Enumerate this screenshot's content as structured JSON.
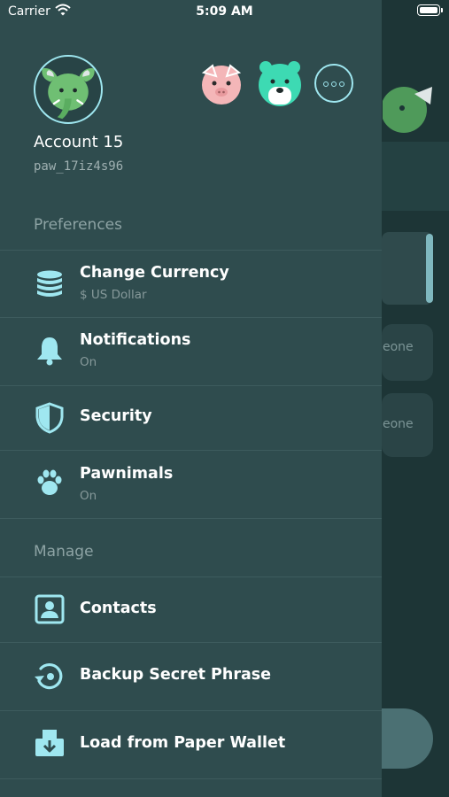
{
  "status_bar": {
    "carrier": "Carrier",
    "time": "5:09 AM"
  },
  "background": {
    "peek_text_1": "eone",
    "peek_text_2": "eone"
  },
  "account": {
    "name": "Account 15",
    "address": "paw_17iz4s96"
  },
  "sections": {
    "preferences": "Preferences",
    "manage": "Manage"
  },
  "preferences_items": [
    {
      "title": "Change Currency",
      "subtitle": "$ US Dollar",
      "icon": "currency-coins-icon"
    },
    {
      "title": "Notifications",
      "subtitle": "On",
      "icon": "bell-icon"
    },
    {
      "title": "Security",
      "icon": "shield-icon"
    },
    {
      "title": "Pawnimals",
      "subtitle": "On",
      "icon": "paw-icon"
    }
  ],
  "manage_items": [
    {
      "title": "Contacts",
      "icon": "contacts-icon"
    },
    {
      "title": "Backup Secret Phrase",
      "icon": "backup-icon"
    },
    {
      "title": "Load from Paper Wallet",
      "icon": "paper-wallet-icon"
    }
  ],
  "colors": {
    "drawer_bg": "#2f4c4e",
    "accent": "#9fe7f0",
    "text_primary": "#ffffff",
    "text_secondary": "#86999a"
  }
}
